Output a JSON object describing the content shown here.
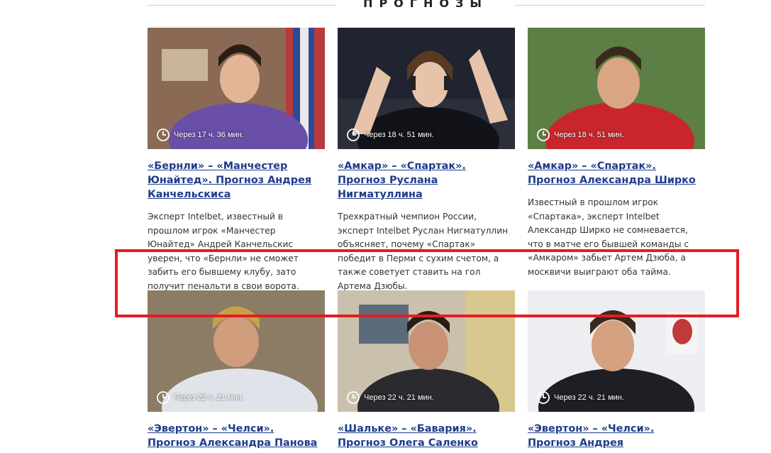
{
  "section": {
    "title": "ПРОГНОЗЫ"
  },
  "cards": [
    {
      "time": "Через 17 ч. 36 мин.",
      "title": "«Бернли» – «Манчестер Юнайтед». Прогноз Андрея Канчельскиса",
      "text": "Эксперт Intelbet, известный в прошлом игрок «Манчестер Юнайтед» Андрей Канчельскис уверен, что «Бернли» не сможет забить его бывшему клубу, зато получит пенальти в свои ворота."
    },
    {
      "time": "Через 18 ч. 51 мин.",
      "title": "«Амкар» – «Спартак». Прогноз Руслана Нигматуллина",
      "text": "Трехкратный чемпион России, эксперт Intelbet Руслан Нигматуллин объясняет, почему «Спартак» победит в Перми с сухим счетом, а также советует ставить на гол Артема Дзюбы."
    },
    {
      "time": "Через 18 ч. 51 мин.",
      "title": "«Амкар» – «Спартак». Прогноз Александра Ширко",
      "text": "Известный в прошлом игрок «Спартака», эксперт Intelbet Александр Ширко не сомневается, что в матче его бывшей команды с «Амкаром» забьет Артем Дзюба, а москвичи выиграют оба тайма."
    },
    {
      "time": "Через 22 ч. 21 мин.",
      "title": "«Эвертон» – «Челси». Прогноз Александра Панова"
    },
    {
      "time": "Через 22 ч. 21 мин.",
      "title": "«Шальке» – «Бавария». Прогноз Олега Саленко"
    },
    {
      "time": "Через 22 ч. 21 мин.",
      "title": "«Эвертон» – «Челси». Прогноз Андрея"
    }
  ],
  "icons": {
    "timer": "clock-icon"
  },
  "colors": {
    "link": "#1f3c8c",
    "highlight": "#e51c24"
  }
}
